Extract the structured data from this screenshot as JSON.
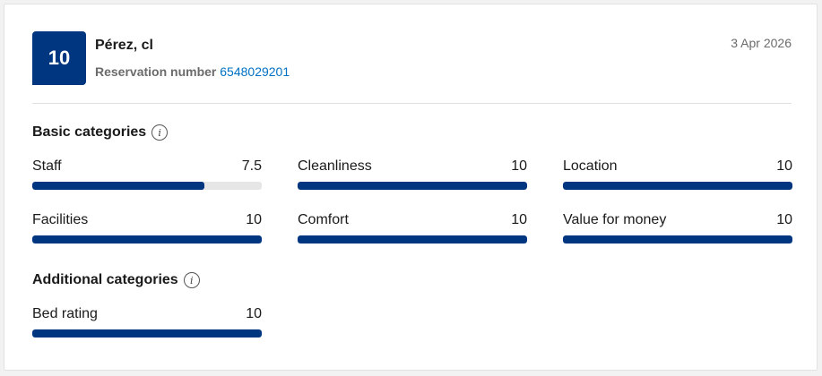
{
  "review": {
    "score": "10",
    "guest_name": "Pérez, cl",
    "reservation_label": "Reservation number",
    "reservation_number": "6548029201",
    "date": "3 Apr 2026"
  },
  "basic": {
    "title": "Basic categories",
    "items": [
      {
        "label": "Staff",
        "value": "7.5",
        "fraction": 0.75
      },
      {
        "label": "Cleanliness",
        "value": "10",
        "fraction": 1.0
      },
      {
        "label": "Location",
        "value": "10",
        "fraction": 1.0
      },
      {
        "label": "Facilities",
        "value": "10",
        "fraction": 1.0
      },
      {
        "label": "Comfort",
        "value": "10",
        "fraction": 1.0
      },
      {
        "label": "Value for money",
        "value": "10",
        "fraction": 1.0
      }
    ]
  },
  "additional": {
    "title": "Additional categories",
    "items": [
      {
        "label": "Bed rating",
        "value": "10",
        "fraction": 1.0
      }
    ]
  },
  "colors": {
    "brand": "#003580",
    "link": "#0071c2",
    "track": "#e6e6e6"
  },
  "icons": {
    "info": "info-circle-icon"
  }
}
